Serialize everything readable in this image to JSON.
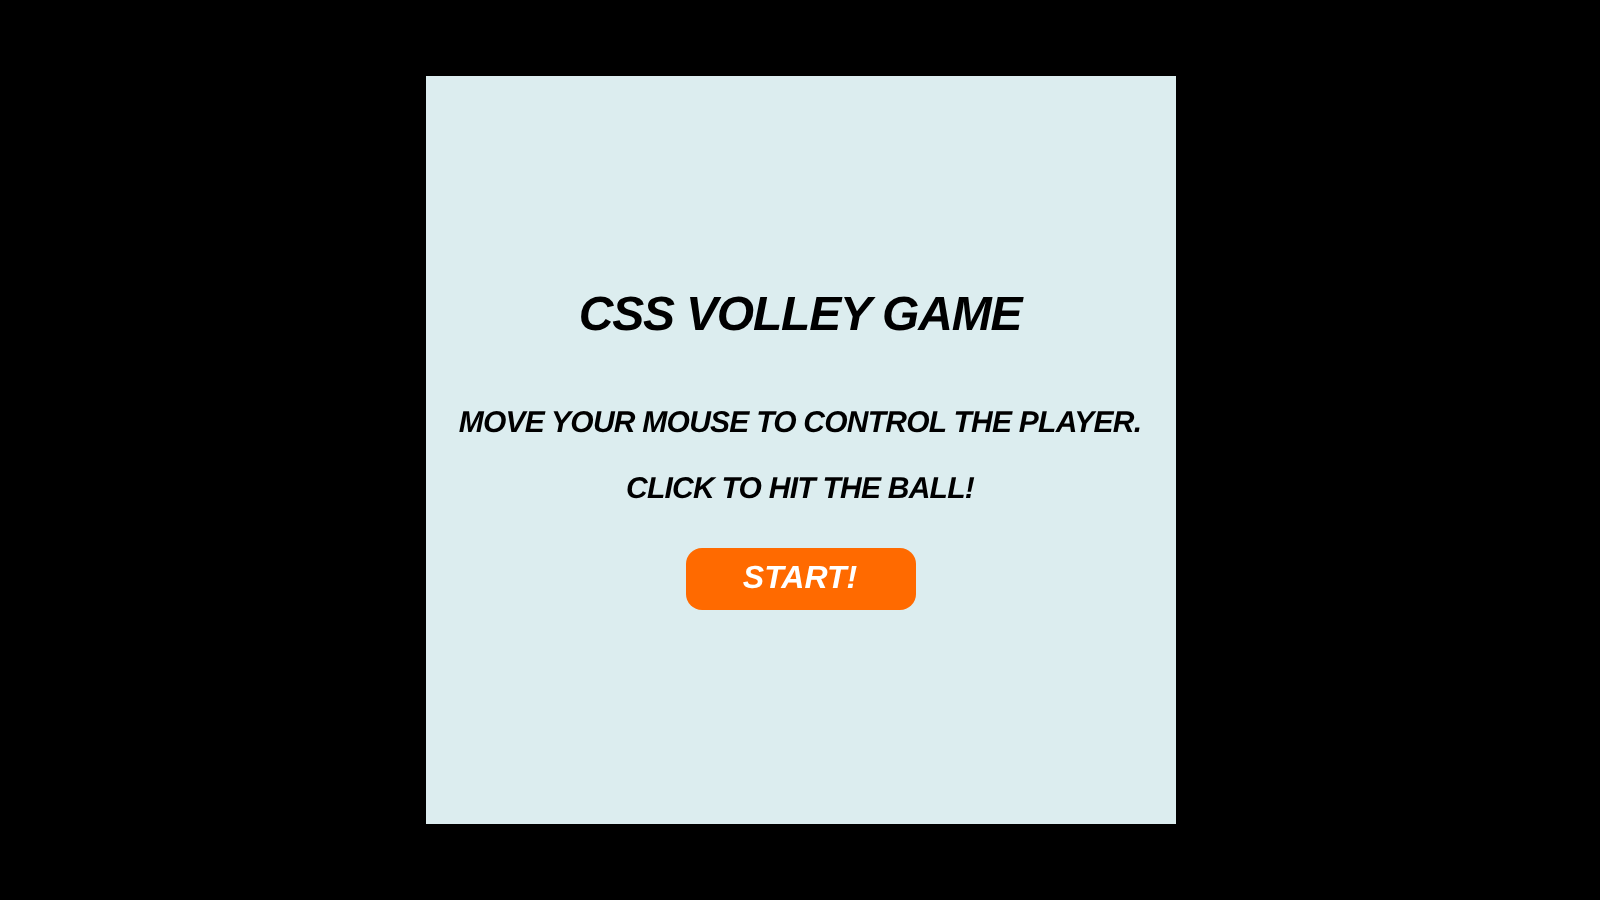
{
  "title": "CSS VOLLEY GAME",
  "instructions": [
    "MOVE YOUR MOUSE TO CONTROL THE PLAYER.",
    "CLICK TO HIT THE BALL!"
  ],
  "start_button": {
    "label": "START!"
  }
}
